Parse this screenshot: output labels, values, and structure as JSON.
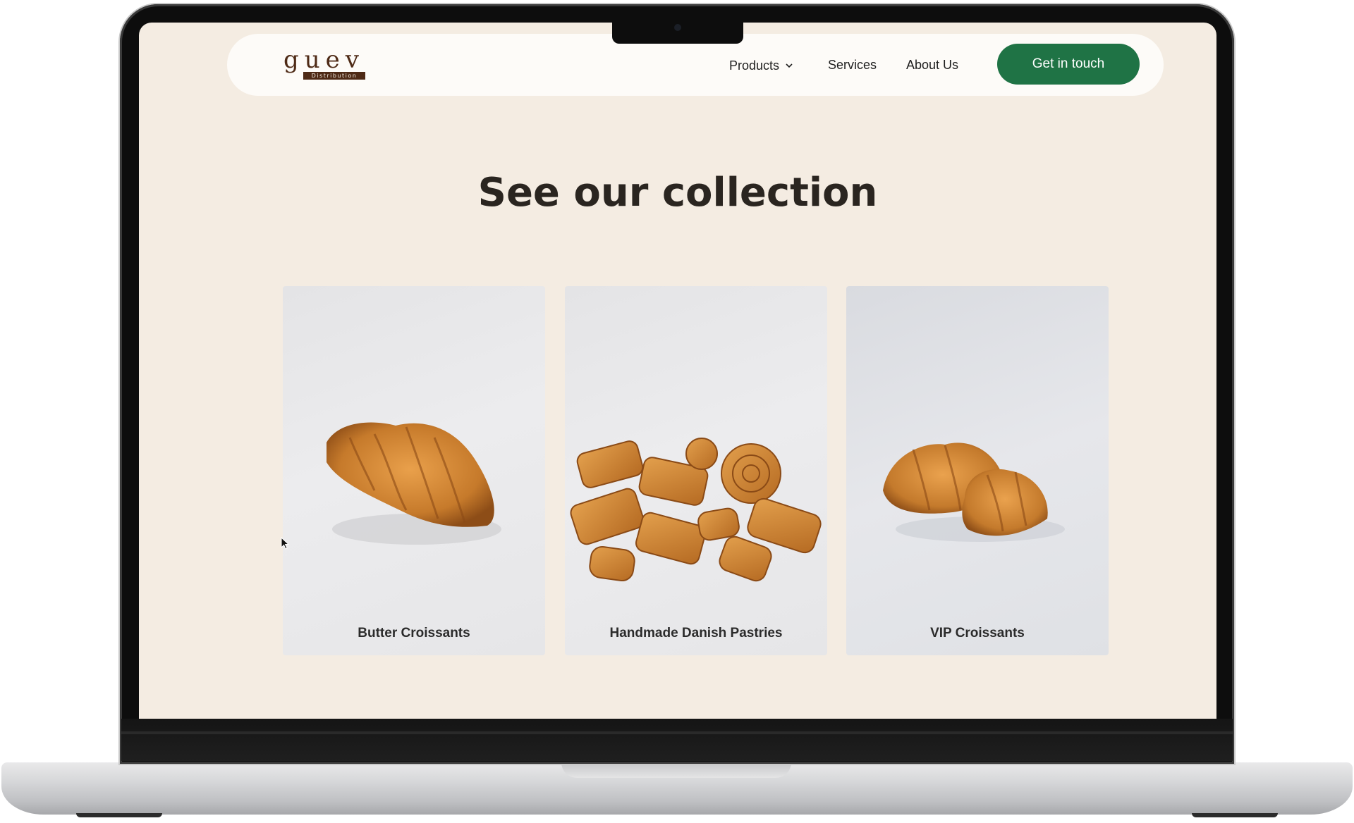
{
  "brand": {
    "logo_word": "guev",
    "logo_sub": "Distribution"
  },
  "nav": {
    "items": [
      {
        "label": "Products",
        "icon": "chevron-down-icon"
      },
      {
        "label": "Services"
      },
      {
        "label": "About Us"
      }
    ],
    "cta_label": "Get in touch"
  },
  "main": {
    "heading": "See our collection",
    "cards": [
      {
        "label": "Butter Croissants"
      },
      {
        "label": "Handmade Danish Pastries"
      },
      {
        "label": "VIP Croissants"
      }
    ]
  },
  "colors": {
    "page_background": "#f4ece2",
    "accent_green": "#1f7345",
    "logo_brown": "#4e2a16",
    "pastry_gold": "#c9822f"
  }
}
